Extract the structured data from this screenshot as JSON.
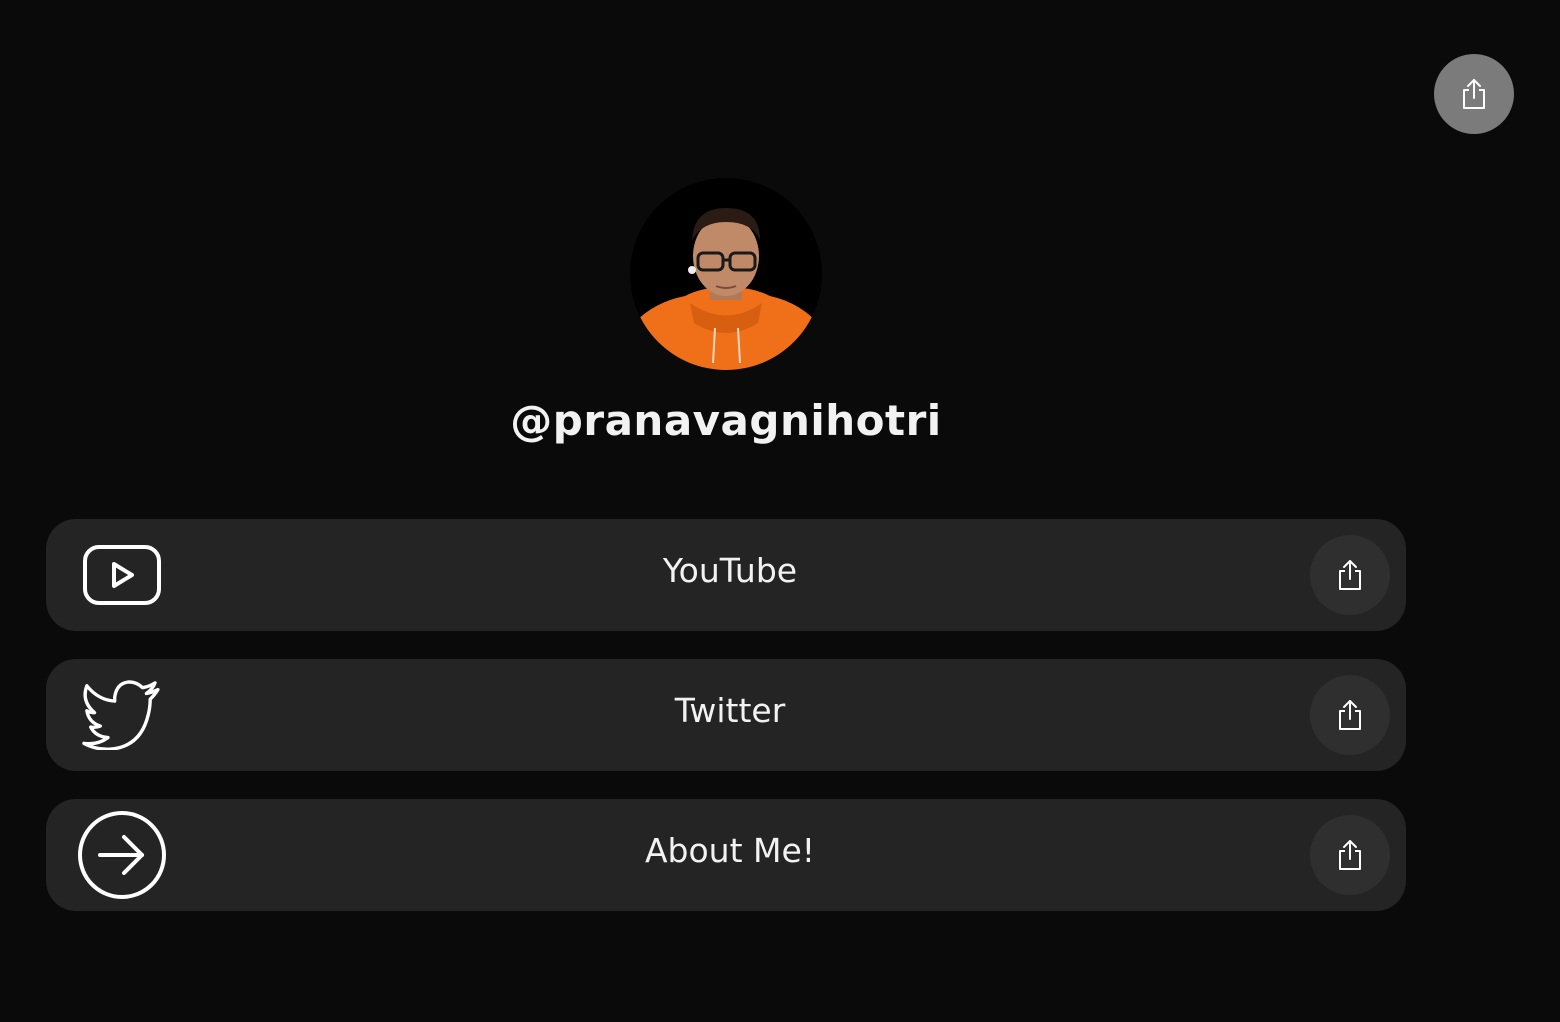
{
  "profile": {
    "username": "@pranavagnihotri",
    "avatar_icon": "profile-photo"
  },
  "header": {
    "share_icon": "share-icon"
  },
  "links": [
    {
      "label": "YouTube",
      "icon": "youtube-icon",
      "share_icon": "share-icon"
    },
    {
      "label": "Twitter",
      "icon": "twitter-icon",
      "share_icon": "share-icon"
    },
    {
      "label": "About Me!",
      "icon": "arrow-right-circle-icon",
      "share_icon": "share-icon"
    }
  ],
  "colors": {
    "background": "#0a0a0a",
    "card": "#242424",
    "share_button": "#2f2f2f",
    "top_share_button": "#7b7b7b",
    "text": "#f2f2f2"
  }
}
